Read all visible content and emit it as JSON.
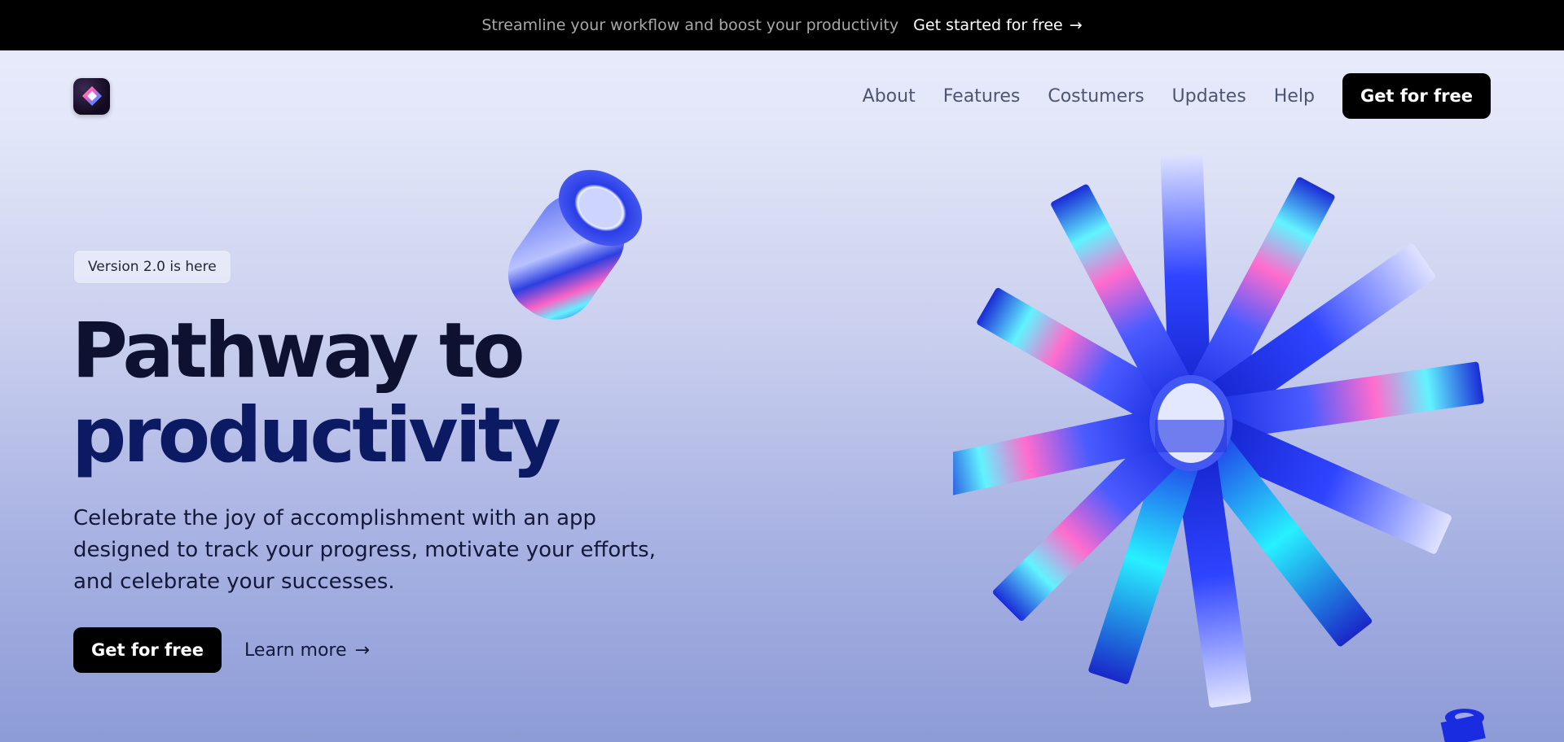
{
  "announcement": {
    "text": "Streamline your workflow and boost your productivity",
    "link_label": "Get started for free",
    "link_arrow": "→"
  },
  "nav": {
    "logo_icon": "diamond-logo-icon",
    "links": [
      "About",
      "Features",
      "Costumers",
      "Updates",
      "Help"
    ],
    "cta_label": "Get for free"
  },
  "hero": {
    "badge": "Version 2.0 is here",
    "headline_line1": "Pathway to",
    "headline_line2": "productivity",
    "subcopy": "Celebrate the joy of accomplishment with an app designed to track your progress, motivate your efforts, and celebrate your successes.",
    "primary_cta": "Get for free",
    "secondary_cta": "Learn more",
    "secondary_arrow": "→"
  },
  "colors": {
    "background_top": "#eaedfd",
    "background_bottom": "#8d9bd6",
    "ink": "#0e1230",
    "headline_accent": "#0c1a63",
    "button": "#000000",
    "art_blue": "#1a2fe0"
  }
}
